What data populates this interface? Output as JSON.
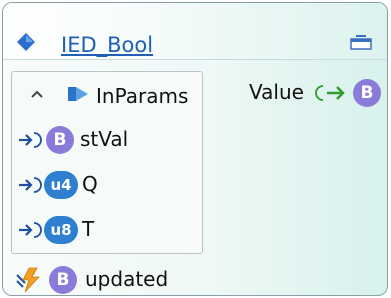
{
  "node": {
    "title": "IED_Bool",
    "params_group": {
      "label": "InParams",
      "rows": [
        {
          "type_badge": "B",
          "label": "stVal"
        },
        {
          "type_badge": "u4",
          "label": "Q"
        },
        {
          "type_badge": "u8",
          "label": "T"
        }
      ]
    },
    "output": {
      "label": "Value",
      "type_badge": "B"
    },
    "event": {
      "type_badge": "B",
      "label": "updated"
    }
  },
  "colors": {
    "accent_blue": "#1f5fb8",
    "bool_badge": "#8b7bd8",
    "uint_badge": "#2f7fd0",
    "arrow_blue": "#1f4fa0",
    "arrow_green": "#2e9b2e",
    "bolt_orange": "#f0a020"
  },
  "icons": {
    "title": "diamond-icon",
    "collapse": "collapse-node-icon",
    "group_toggle": "chevron-up-icon",
    "group": "folder-input-icon",
    "input_port": "input-arrow-icon",
    "output_port": "output-arrow-icon",
    "event": "event-bolt-icon"
  }
}
